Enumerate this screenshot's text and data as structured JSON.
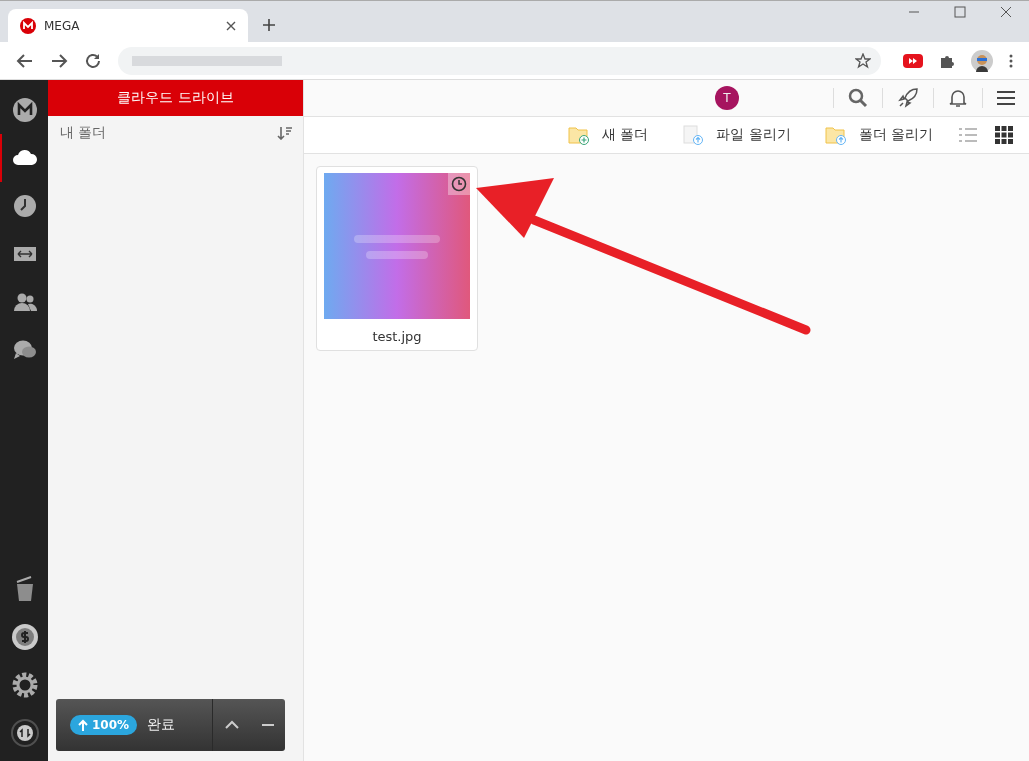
{
  "browser": {
    "tab_title": "MEGA"
  },
  "rail": {
    "top": [
      {
        "kind": "logo",
        "selected": false
      },
      {
        "kind": "cloud",
        "selected": true
      },
      {
        "kind": "clock",
        "selected": false
      },
      {
        "kind": "transfer",
        "selected": false
      },
      {
        "kind": "contacts",
        "selected": false
      },
      {
        "kind": "chat",
        "selected": false
      }
    ],
    "bottom": [
      {
        "kind": "trash",
        "selected": false
      },
      {
        "kind": "coin",
        "selected": false
      },
      {
        "kind": "gear",
        "selected": false
      },
      {
        "kind": "sync",
        "selected": false
      }
    ]
  },
  "sidebar": {
    "title": "클라우드 드라이브",
    "folder": "내 폴더"
  },
  "header": {
    "avatar": "T"
  },
  "toolbar": {
    "actions": [
      {
        "label": "새 폴더",
        "kind": "new-folder"
      },
      {
        "label": "파일 올리기",
        "kind": "upload-file"
      },
      {
        "label": "폴더 올리기",
        "kind": "upload-folder"
      }
    ],
    "view_modes": [
      {
        "kind": "list",
        "selected": false
      },
      {
        "kind": "grid",
        "selected": true
      }
    ]
  },
  "files": [
    {
      "name": "test.jpg",
      "kind": "picture"
    }
  ],
  "transfer": {
    "percent": "100%",
    "status": "완료"
  }
}
